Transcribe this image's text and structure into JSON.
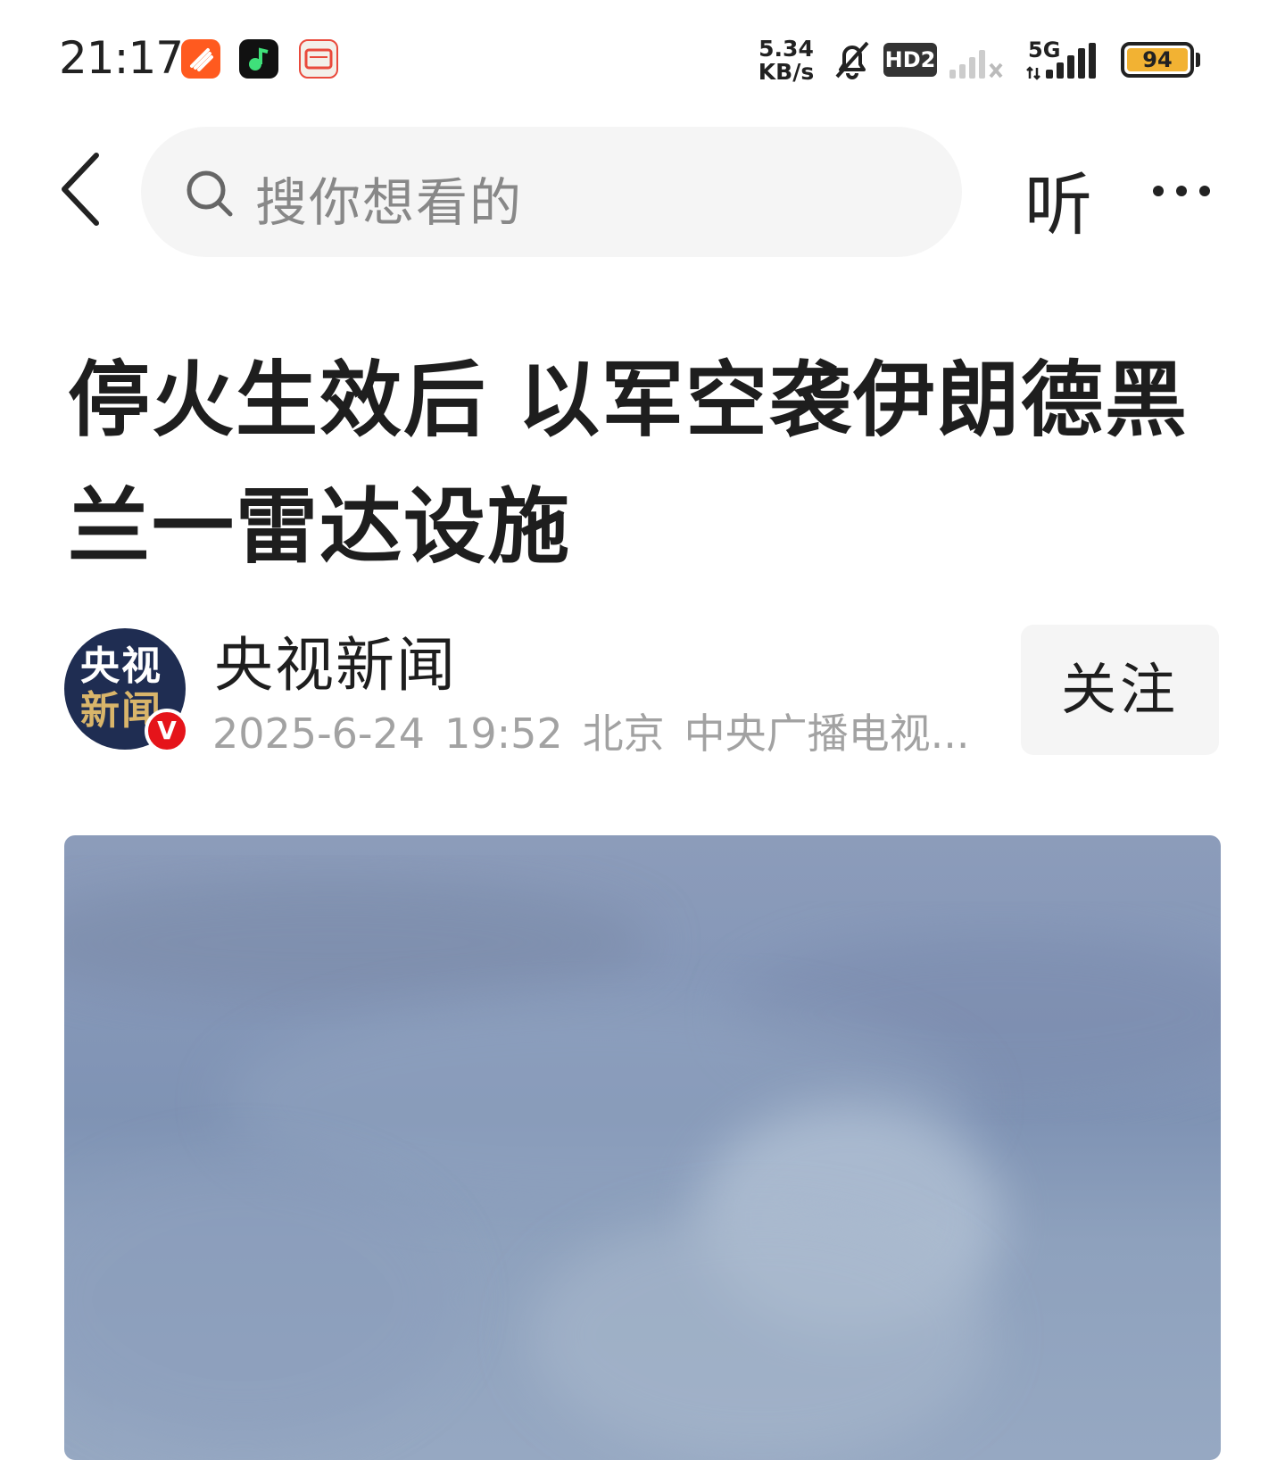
{
  "status_bar": {
    "time": "21:17",
    "net_speed_value": "5.34",
    "net_speed_unit": "KB/s",
    "hd_badge": "HD2",
    "network_type": "5G",
    "battery_level": "94",
    "icons": [
      "app-flight-icon",
      "app-music-icon",
      "app-calendar-icon",
      "bell-muted-icon",
      "signal-sim1-icon",
      "signal-sim2-icon",
      "battery-icon"
    ]
  },
  "top_nav": {
    "search_placeholder": "搜你想看的",
    "listen_label": "听"
  },
  "article": {
    "title": "停火生效后 以军空袭伊朗德黑兰一雷达设施",
    "author": {
      "name": "央视新闻",
      "avatar_line1": "央视",
      "avatar_line2": "新闻",
      "verified_mark": "V",
      "date": "2025-6-24",
      "time": "19:52",
      "location": "北京",
      "source": "中央广播电视..."
    },
    "follow_label": "关注"
  },
  "colors": {
    "accent_red": "#e5141a",
    "search_bg": "#f5f5f5",
    "meta_gray": "#a2a2a2"
  }
}
